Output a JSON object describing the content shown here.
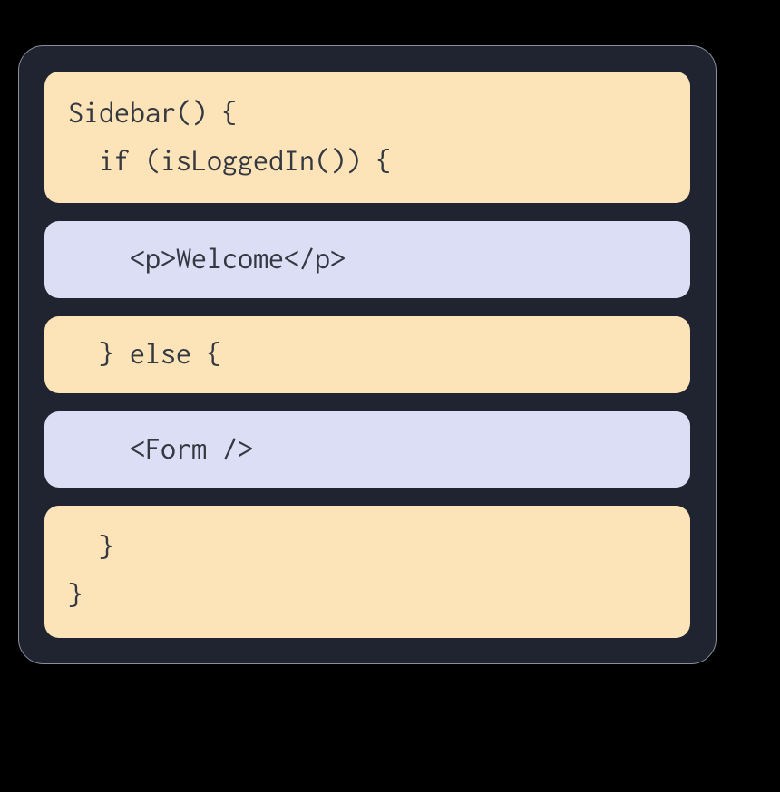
{
  "diagram": {
    "blocks": [
      {
        "variant": "yellow",
        "text": "Sidebar() {\n  if (isLoggedIn()) {"
      },
      {
        "variant": "purple",
        "text": "    <p>Welcome</p>"
      },
      {
        "variant": "yellow",
        "text": "  } else {"
      },
      {
        "variant": "purple",
        "text": "    <Form />"
      },
      {
        "variant": "yellow",
        "text": "  }\n}"
      }
    ]
  }
}
